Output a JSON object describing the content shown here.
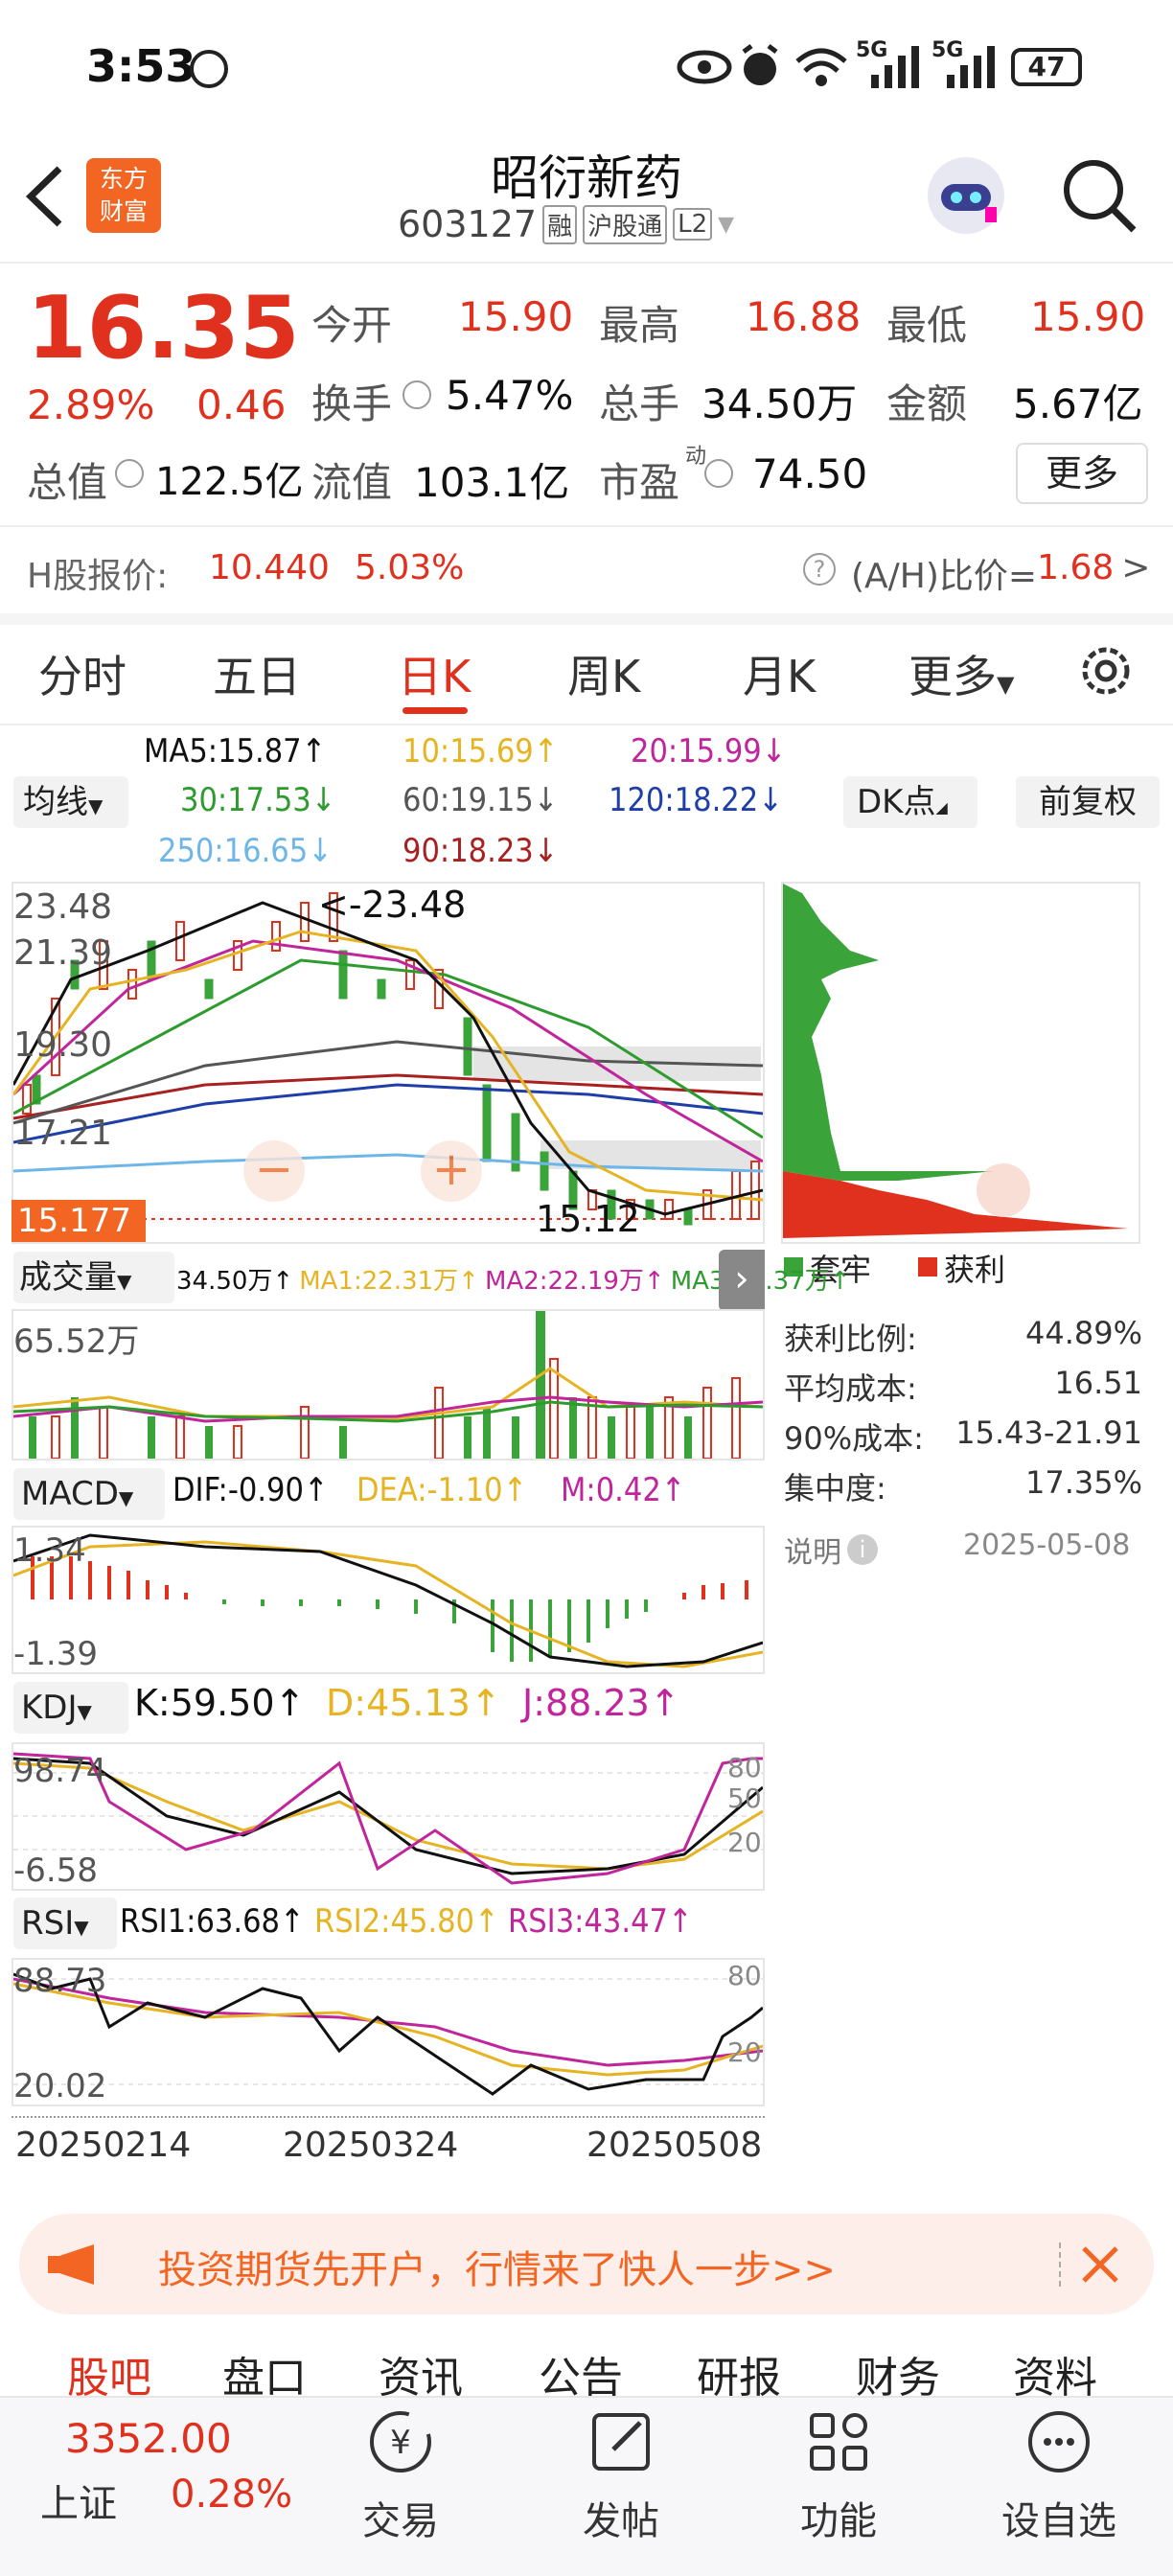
{
  "status": {
    "time": "3:53",
    "battery": "47",
    "net1": "5G",
    "net2": "5G"
  },
  "header": {
    "logo_line1": "东方",
    "logo_line2": "财富",
    "title": "昭衍新药",
    "code": "603127",
    "tag_rong": "融",
    "tag_hgt": "沪股通",
    "tag_l2": "L2"
  },
  "quote": {
    "price": "16.35",
    "pct": "2.89%",
    "chg": "0.46",
    "open_label": "今开",
    "open": "15.90",
    "high_label": "最高",
    "high": "16.88",
    "low_label": "最低",
    "low": "15.90",
    "turnover_label": "换手",
    "turnover": "5.47%",
    "volume_label": "总手",
    "volume": "34.50万",
    "amount_label": "金额",
    "amount": "5.67亿",
    "mcap_label": "总值",
    "mcap": "122.5亿",
    "float_label": "流值",
    "float": "103.1亿",
    "pe_label": "市盈",
    "pe_sup": "动",
    "pe": "74.50",
    "more": "更多",
    "h_label": "H股报价:",
    "h_price": "10.440",
    "h_pct": "5.03%",
    "ah_label": "(A/H)比价=",
    "ah_value": "1.68"
  },
  "tabs": [
    "分时",
    "五日",
    "日K",
    "周K",
    "月K",
    "更多"
  ],
  "active_tab": "日K",
  "ma": {
    "selector": "均线",
    "ma5": "MA5:15.87↑",
    "ma10": "10:15.69↑",
    "ma20": "20:15.99↓",
    "ma30": "30:17.53↓",
    "ma60": "60:19.15↓",
    "ma120": "120:18.22↓",
    "ma250": "250:16.65↓",
    "ma90": "90:18.23↓",
    "dk": "DK点",
    "fq": "前复权"
  },
  "kchart": {
    "y_ticks": [
      "23.48",
      "21.39",
      "19.30",
      "17.21"
    ],
    "high_mark": "<-23.48",
    "low_mark": "15.12",
    "cursor_price": "15.177"
  },
  "volume": {
    "selector": "成交量",
    "v": "34.50万↑",
    "ma1": "MA1:22.31万↑",
    "ma2": "MA2:22.19万↑",
    "ma3": "MA3:24.37万↑",
    "max": "65.52万"
  },
  "macd": {
    "selector": "MACD",
    "dif": "DIF:-0.90↑",
    "dea": "DEA:-1.10↑",
    "m": "M:0.42↑",
    "top": "1.34",
    "bottom": "-1.39"
  },
  "kdj": {
    "selector": "KDJ",
    "k": "K:59.50↑",
    "d": "D:45.13↑",
    "j": "J:88.23↑",
    "top": "98.74",
    "bottom": "-6.58",
    "r1": "80",
    "r2": "50",
    "r3": "20"
  },
  "rsi": {
    "selector": "RSI",
    "r1": "RSI1:63.68↑",
    "r2": "RSI2:45.80↑",
    "r3": "RSI3:43.47↑",
    "top": "88.73",
    "bottom": "20.02",
    "m1": "80",
    "m2": "20"
  },
  "dates": [
    "20250214",
    "20250324",
    "20250508"
  ],
  "chip": {
    "legend_solid": "套牢",
    "legend_profit": "获利",
    "rows": [
      {
        "label": "获利比例:",
        "value": "44.89%"
      },
      {
        "label": "平均成本:",
        "value": "16.51"
      },
      {
        "label": "90%成本:",
        "value": "15.43-21.91"
      },
      {
        "label": "集中度:",
        "value": "17.35%"
      }
    ],
    "note": "说明",
    "date": "2025-05-08"
  },
  "banner": {
    "text": "投资期货先开户，行情来了快人一步>>"
  },
  "bottom_tabs": [
    "股吧",
    "盘口",
    "资讯",
    "公告",
    "研报",
    "财务",
    "资料"
  ],
  "index": {
    "value": "3352.00",
    "name": "上证",
    "pct": "0.28%"
  },
  "bottom_nav": [
    "交易",
    "发帖",
    "功能",
    "设自选"
  ],
  "colors": {
    "up": "#e0301e",
    "down": "#3aa33a",
    "accent": "#f26522"
  }
}
